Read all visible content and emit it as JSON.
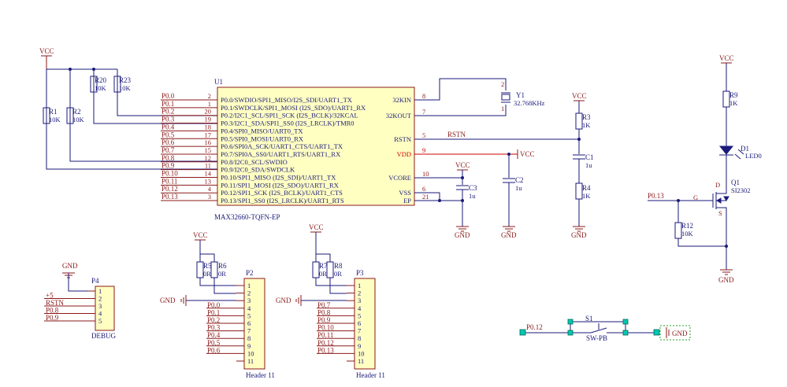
{
  "power": {
    "vcc": "VCC",
    "gnd": "GND",
    "plus5": "+5"
  },
  "nets": {
    "rstn": "RSTN",
    "p013": "P0.13",
    "p012": "P0.12"
  },
  "resistors": {
    "r1": {
      "ref": "R1",
      "value": "10K"
    },
    "r2": {
      "ref": "R2",
      "value": "10K"
    },
    "r20": {
      "ref": "R20",
      "value": "10K"
    },
    "r23": {
      "ref": "R23",
      "value": "10K"
    },
    "r3": {
      "ref": "R3",
      "value": "1K"
    },
    "r4": {
      "ref": "R4",
      "value": "1K"
    },
    "r9": {
      "ref": "R9",
      "value": "1K"
    },
    "r12": {
      "ref": "R12",
      "value": "10K"
    },
    "r5": {
      "ref": "R5",
      "value": "0R"
    },
    "r6": {
      "ref": "R6",
      "value": "0R"
    },
    "r7": {
      "ref": "R7",
      "value": "0R"
    },
    "r8": {
      "ref": "R8",
      "value": "0R"
    }
  },
  "caps": {
    "c1": {
      "ref": "C1",
      "value": "1u"
    },
    "c2": {
      "ref": "C2",
      "value": "1u"
    },
    "c3": {
      "ref": "C3",
      "value": "1u"
    }
  },
  "y1": {
    "ref": "Y1",
    "value": "32.768KHz",
    "pin_top": "2",
    "pin_bottom": "1"
  },
  "led": {
    "ref": "D1",
    "value": "LED0"
  },
  "mosfet": {
    "ref": "Q1",
    "part": "SI2302",
    "pin_d": "D",
    "pin_g": "G",
    "pin_s": "S"
  },
  "switch": {
    "ref": "S1",
    "part": "SW-PB"
  },
  "u1": {
    "ref": "U1",
    "part": "MAX32660-TQFN-EP",
    "left_pins": [
      {
        "net": "P0.0",
        "num": "2",
        "func": "P0.0/SWDIO/SPI1_MISO/I2S_SDI/UART1_TX"
      },
      {
        "net": "P0.1",
        "num": "1",
        "func": "P0.1/SWDCLK/SPI1_MOSI (I2S_SDO)/UART1_RX"
      },
      {
        "net": "P0.2",
        "num": "20",
        "func": "P0.2/I2C1_SCL/SPI1_SCK (I2S_BCLK)/32KCAL"
      },
      {
        "net": "P0.3",
        "num": "19",
        "func": "P0.3/I2C1_SDA/SPI1_SS0 (I2S_LRCLK)/TMR0"
      },
      {
        "net": "P0.4",
        "num": "18",
        "func": "P0.4/SPI0_MISO/UART0_TX"
      },
      {
        "net": "P0.5",
        "num": "17",
        "func": "P0.5/SPI0_MOSI/UART0_RX"
      },
      {
        "net": "P0.6",
        "num": "16",
        "func": "P0.6/SPI0A_SCK/UART1_CTS/UART1_TX"
      },
      {
        "net": "P0.7",
        "num": "15",
        "func": "P0.7/SPI0A_SS0/UART1_RTS/UART1_RX"
      },
      {
        "net": "P0.8",
        "num": "12",
        "func": "P0.8/I2C0_SCL/SWDIO"
      },
      {
        "net": "P0.9",
        "num": "11",
        "func": "P0.9/I2C0_SDA/SWDCLK"
      },
      {
        "net": "P0.10",
        "num": "14",
        "func": "P0.10/SPI1_MISO (I2S_SDI)/UART1_TX"
      },
      {
        "net": "P0.11",
        "num": "13",
        "func": "P0.11/SPI1_MOSI (I2S_SDO)/UART1_RX"
      },
      {
        "net": "P0.12",
        "num": "4",
        "func": "P0.12/SPI1_SCK (I2S_BCLK)/UART1_CTS"
      },
      {
        "net": "P0.13",
        "num": "3",
        "func": "P0.13/SPI1_SS0 (I2S_LRCLK)/UART1_RTS"
      }
    ],
    "right_pins": [
      {
        "func": "32KIN",
        "num": "8"
      },
      {
        "func": "32KOUT",
        "num": "7"
      },
      {
        "func": "RSTN",
        "num": "5"
      },
      {
        "func": "VDD",
        "num": "9",
        "highlight": true
      },
      {
        "func": "VCORE",
        "num": "10"
      },
      {
        "func": "VSS",
        "num": "6"
      },
      {
        "func": "EP",
        "num": "21"
      }
    ]
  },
  "p4": {
    "ref": "P4",
    "label": "DEBUG",
    "pins": [
      {
        "num": "1",
        "net": ""
      },
      {
        "num": "2",
        "net": "+5"
      },
      {
        "num": "3",
        "net": "RSTN"
      },
      {
        "num": "4",
        "net": "P0.8"
      },
      {
        "num": "5",
        "net": "P0.9"
      }
    ]
  },
  "p2": {
    "ref": "P2",
    "label": "Header 11",
    "pins": [
      {
        "num": "1",
        "net": ""
      },
      {
        "num": "2",
        "net": ""
      },
      {
        "num": "3",
        "net": ""
      },
      {
        "num": "4",
        "net": "P0.0"
      },
      {
        "num": "5",
        "net": "P0.1"
      },
      {
        "num": "6",
        "net": "P0.2"
      },
      {
        "num": "7",
        "net": "P0.3"
      },
      {
        "num": "8",
        "net": "P0.4"
      },
      {
        "num": "9",
        "net": "P0.5"
      },
      {
        "num": "10",
        "net": "P0.6"
      },
      {
        "num": "11",
        "net": ""
      }
    ]
  },
  "p3": {
    "ref": "P3",
    "label": "Header 11",
    "pins": [
      {
        "num": "1",
        "net": ""
      },
      {
        "num": "2",
        "net": ""
      },
      {
        "num": "3",
        "net": ""
      },
      {
        "num": "4",
        "net": "P0.7"
      },
      {
        "num": "5",
        "net": "P0.8"
      },
      {
        "num": "6",
        "net": "P0.9"
      },
      {
        "num": "7",
        "net": "P0.10"
      },
      {
        "num": "8",
        "net": "P0.11"
      },
      {
        "num": "9",
        "net": "P0.12"
      },
      {
        "num": "10",
        "net": "P0.13"
      },
      {
        "num": "11",
        "net": ""
      }
    ]
  }
}
